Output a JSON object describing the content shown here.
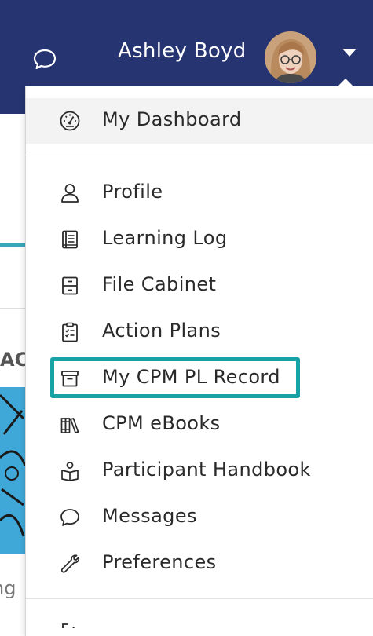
{
  "header": {
    "user_name": "Ashley Boyd",
    "background_color": "#263471",
    "icons": [
      "chat-bubble-icon",
      "user-avatar",
      "caret-down-icon"
    ]
  },
  "background": {
    "partial_heading": "AC",
    "partial_text": "ng"
  },
  "menu": {
    "highlight_color": "#17a2a6",
    "items": [
      {
        "label": "My Dashboard",
        "icon": "speedometer-icon"
      },
      {
        "label": "Profile",
        "icon": "person-icon"
      },
      {
        "label": "Learning Log",
        "icon": "notebook-icon"
      },
      {
        "label": "File Cabinet",
        "icon": "file-cabinet-icon"
      },
      {
        "label": "Action Plans",
        "icon": "clipboard-checklist-icon"
      },
      {
        "label": "My CPM PL Record",
        "icon": "archive-box-icon",
        "highlighted": true
      },
      {
        "label": "CPM eBooks",
        "icon": "books-icon"
      },
      {
        "label": "Participant Handbook",
        "icon": "open-book-person-icon"
      },
      {
        "label": "Messages",
        "icon": "chat-bubble-icon"
      },
      {
        "label": "Preferences",
        "icon": "wrench-icon"
      }
    ]
  }
}
